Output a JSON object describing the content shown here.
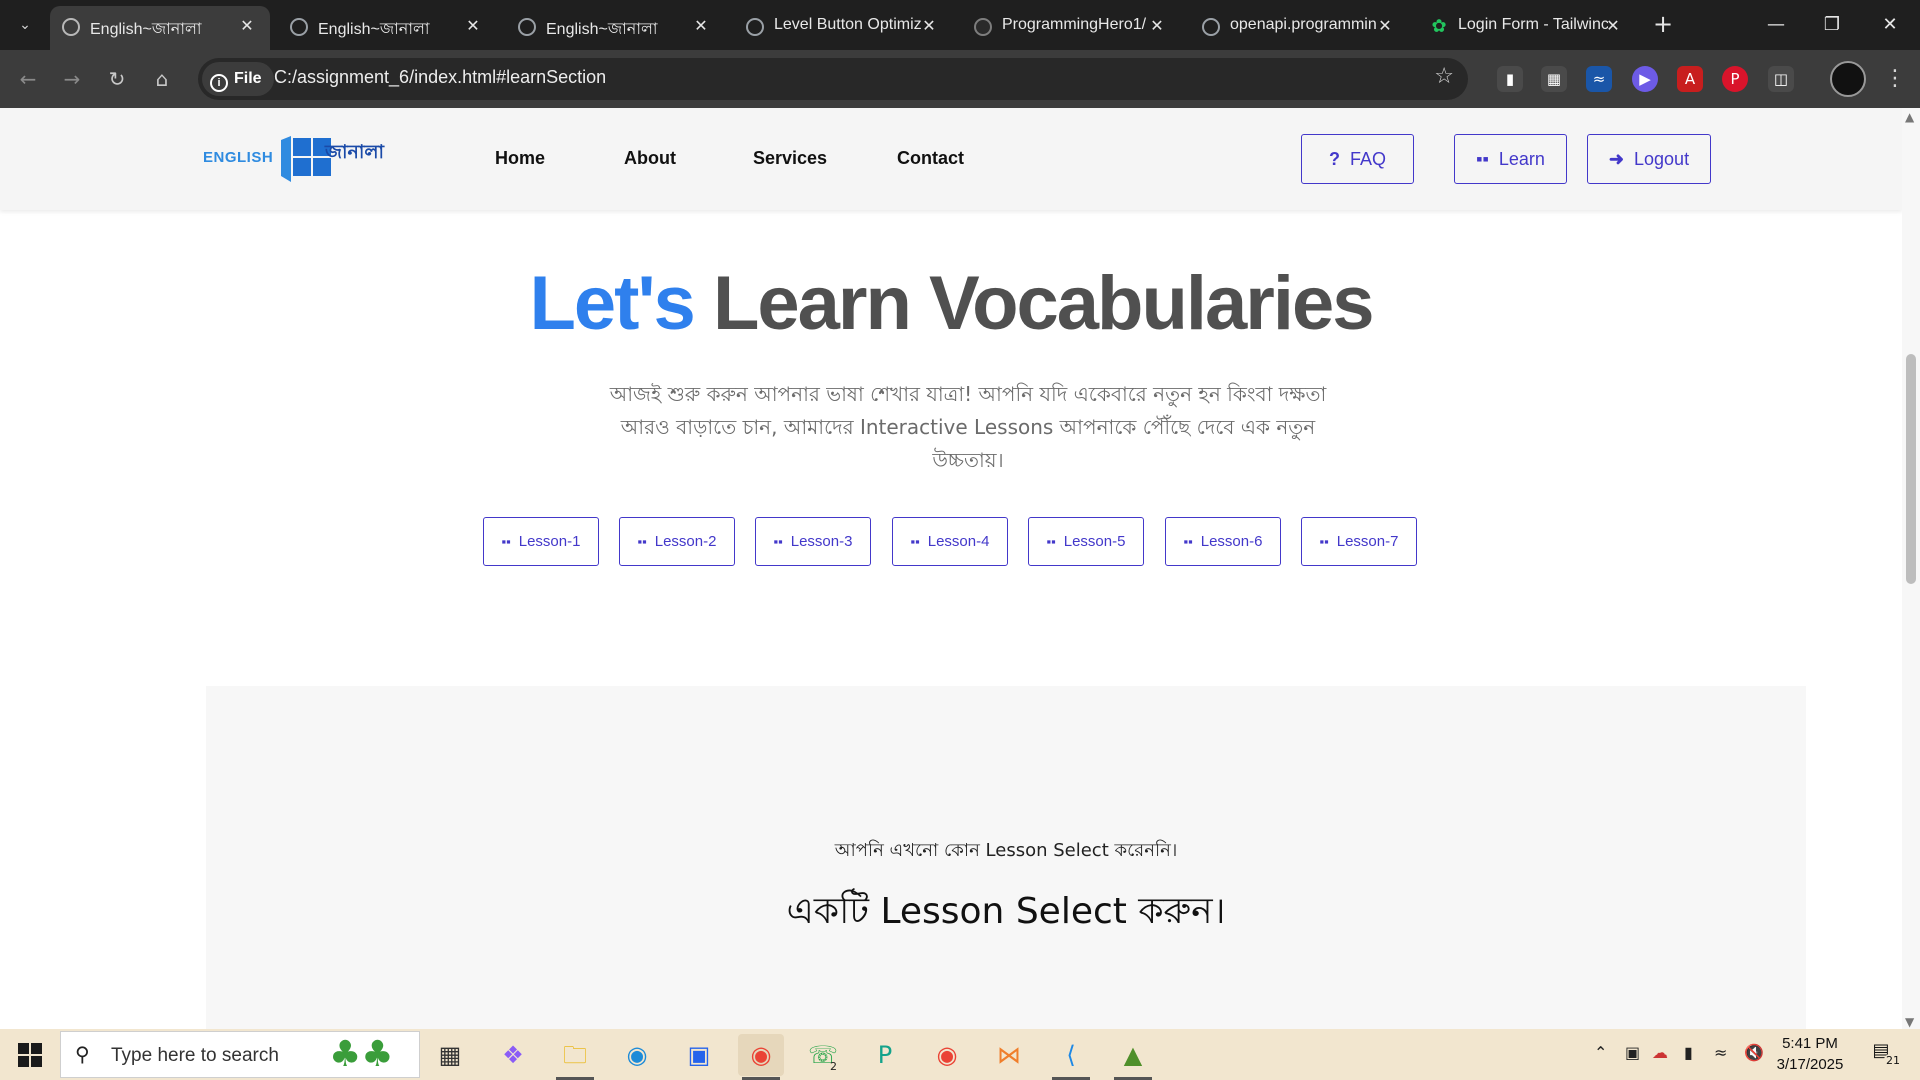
{
  "browser": {
    "tabs": [
      {
        "title": "English~জানালা",
        "active": true
      },
      {
        "title": "English~জানালা",
        "active": false
      },
      {
        "title": "English~জানালা",
        "active": false
      },
      {
        "title": "Level Button Optimiz",
        "active": false
      },
      {
        "title": "ProgrammingHero1/",
        "active": false
      },
      {
        "title": "openapi.programmin",
        "active": false
      },
      {
        "title": "Login Form - Tailwinc",
        "active": false
      }
    ],
    "address": {
      "scheme_label": "File",
      "url": "C:/assignment_6/index.html#learnSection"
    }
  },
  "site": {
    "logo": {
      "en": "ENGLISH",
      "bn": "জানালা"
    },
    "nav_links": [
      "Home",
      "About",
      "Services",
      "Contact"
    ],
    "nav_buttons": {
      "faq": "FAQ",
      "learn": "Learn",
      "logout": "Logout"
    },
    "hero": {
      "title_accent": "Let's",
      "title_rest": "Learn Vocabularies",
      "subtitle": "আজই শুরু করুন আপনার ভাষা শেখার যাত্রা! আপনি যদি একেবারে নতুন হন কিংবা দক্ষতা আরও বাড়াতে চান, আমাদের Interactive Lessons আপনাকে পৌঁছে দেবে এক নতুন উচ্চতায়।"
    },
    "lessons": [
      "Lesson-1",
      "Lesson-2",
      "Lesson-3",
      "Lesson-4",
      "Lesson-5",
      "Lesson-6",
      "Lesson-7"
    ],
    "empty_state": {
      "note": "আপনি এখনো কোন Lesson Select করেননি।",
      "prompt": "একটি Lesson Select করুন।"
    },
    "colors": {
      "accent": "#2f80ed",
      "button": "#4338ca",
      "heading": "#505050"
    }
  },
  "taskbar": {
    "search_placeholder": "Type here to search",
    "time": "5:41 PM",
    "date": "3/17/2025",
    "whatsapp_badge": "2",
    "notification_count": "21"
  }
}
